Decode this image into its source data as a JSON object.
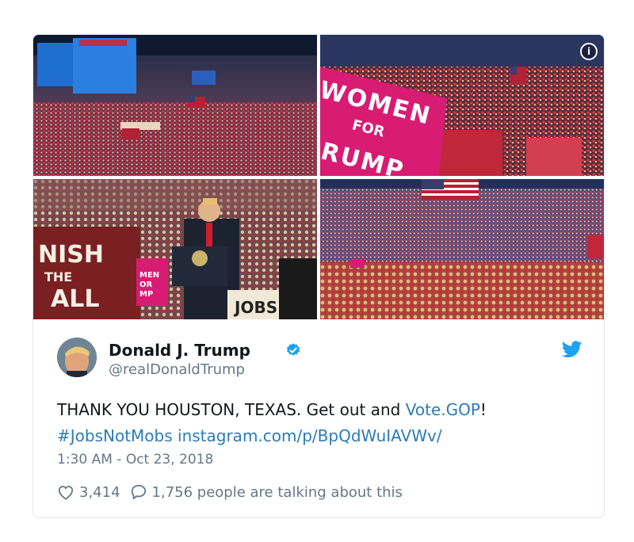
{
  "tweet": {
    "author_name": "Donald J. Trump",
    "handle": "@realDonaldTrump",
    "text_main": "THANK YOU HOUSTON, TEXAS. Get out and ",
    "text_link": "Vote.GOP",
    "text_end": "!",
    "hashtag": "#JobsNotMobs",
    "url": "instagram.com/p/BpQdWuIAVWv/",
    "timestamp": "1:30 AM - Oct 23, 2018",
    "likes": "3,414",
    "talking": "1,756 people are talking about this"
  },
  "media": {
    "info_icon": "i",
    "sign_women_line1": "WOMEN",
    "sign_women_line2": "FOR",
    "sign_women_line3": "RUMP",
    "sign_finish_line1": "NISH",
    "sign_finish_line2": "THE",
    "sign_finish_line3": "ALL",
    "sign_jobs": "JOBS",
    "sign_small_women": "MEN",
    "sign_small_for": "OR",
    "sign_small_trump": "MP"
  },
  "colors": {
    "link": "#2b7bb9",
    "verified": "#1da1f2",
    "twitter_bird": "#1da1f2",
    "crowd_red": "#c8283a",
    "sign_pink": "#d81b73"
  },
  "icons": [
    "verified-badge-icon",
    "twitter-bird-icon",
    "heart-icon",
    "reply-bubble-icon",
    "info-icon"
  ]
}
